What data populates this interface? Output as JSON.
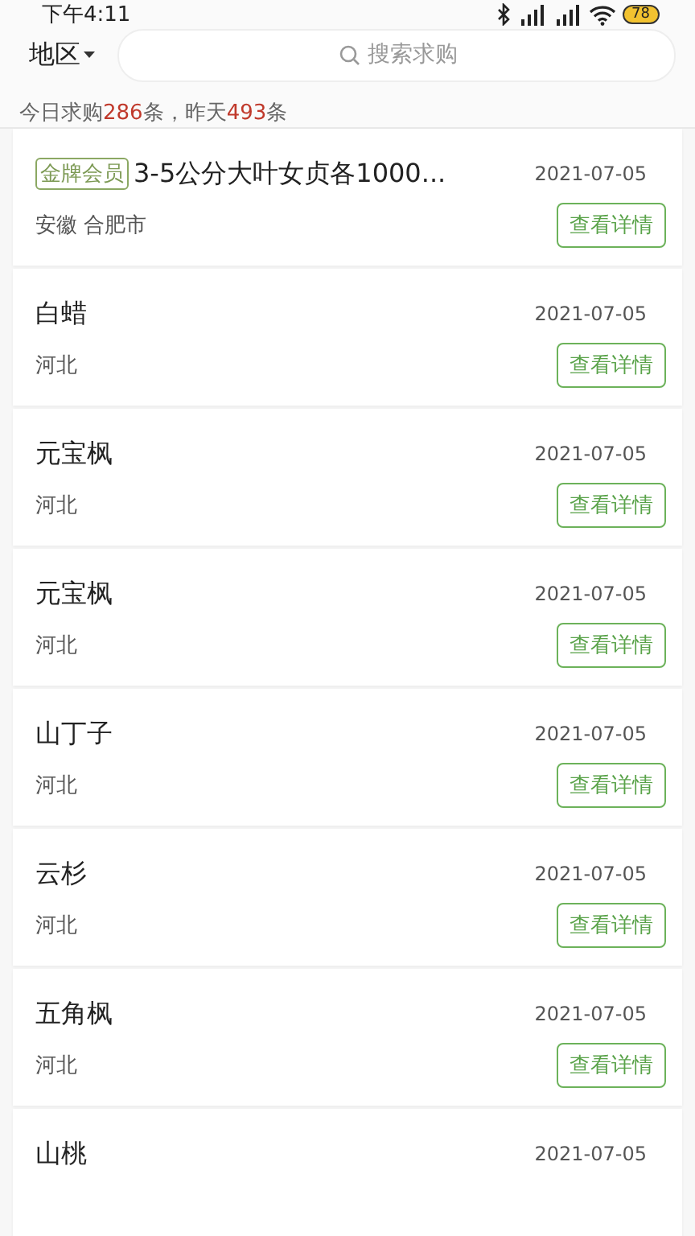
{
  "status_bar": {
    "time": "下午4:11",
    "battery": "78"
  },
  "header": {
    "region": "地区",
    "search": {
      "placeholder": "搜索求购"
    }
  },
  "stats": "今日求购**286**条，昨天**493**条",
  "items": [
    {
      "badge": "金牌会员",
      "title": "3-5公分大叶女贞各1000...",
      "date": "2021-07-05",
      "location": "安徽 合肥市",
      "button": "查看详情"
    },
    {
      "title": "白蜡",
      "date": "2021-07-05",
      "location": "河北",
      "button": "查看详情"
    },
    {
      "title": "元宝枫",
      "date": "2021-07-05",
      "location": "河北",
      "button": "查看详情"
    },
    {
      "title": "元宝枫",
      "date": "2021-07-05",
      "location": "河北",
      "button": "查看详情"
    },
    {
      "title": "山丁子",
      "date": "2021-07-05",
      "location": "河北",
      "button": "查看详情"
    },
    {
      "title": "云杉",
      "date": "2021-07-05",
      "location": "河北",
      "button": "查看详情"
    },
    {
      "title": "五角枫",
      "date": "2021-07-05",
      "location": "河北",
      "button": "查看详情"
    },
    {
      "title": "山桃",
      "date": "2021-07-05"
    }
  ]
}
